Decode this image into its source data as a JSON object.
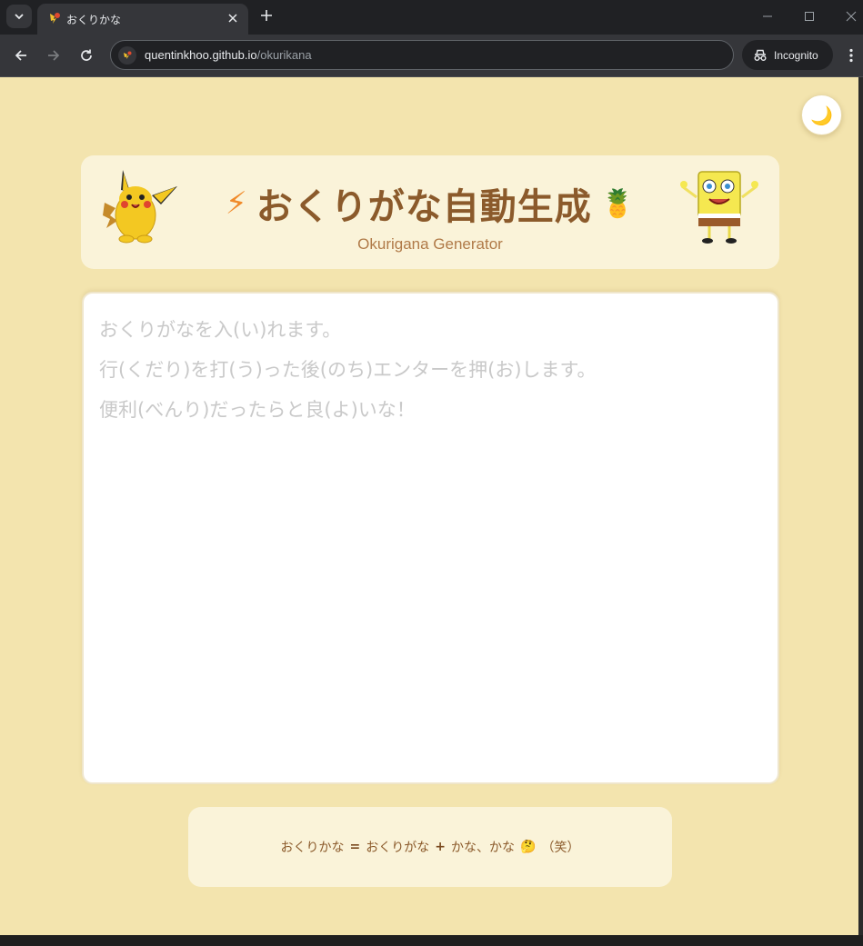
{
  "browser": {
    "tab_title": "おくりかな",
    "url_host": "quentinkhoo.github.io",
    "url_path": "/okurikana",
    "incognito_label": "Incognito"
  },
  "page": {
    "theme_toggle_icon": "🌙",
    "title_left_emoji": "⚡",
    "title": "おくりがな自動生成",
    "title_right_emoji": "🍍",
    "subtitle": "Okurigana Generator",
    "editor_placeholder": "おくりがなを入(い)れます。\n行(くだり)を打(う)った後(のち)エンターを押(お)します。\n便利(べんり)だったらと良(よ)いな！",
    "footer": {
      "term1": "おくりかな",
      "eq": "=",
      "term2": "おくりがな",
      "plus": "+",
      "term3": "かな、かな",
      "emoji": "🤔",
      "tail": "（笑）"
    }
  },
  "colors": {
    "page_bg": "#f3e4ae",
    "card_bg": "#faf3d9",
    "title": "#8b5a2b",
    "subtitle": "#b07a48",
    "placeholder": "#c9c9c9"
  },
  "icons": [
    "tab-list-icon",
    "pikachu-favicon",
    "close-icon",
    "plus-icon",
    "minimize-icon",
    "maximize-icon",
    "window-close-icon",
    "back-icon",
    "forward-icon",
    "reload-icon",
    "site-info-icon",
    "incognito-icon",
    "menu-icon",
    "moon-icon",
    "pikachu-image",
    "spongebob-image",
    "lightning-icon",
    "pineapple-icon"
  ]
}
